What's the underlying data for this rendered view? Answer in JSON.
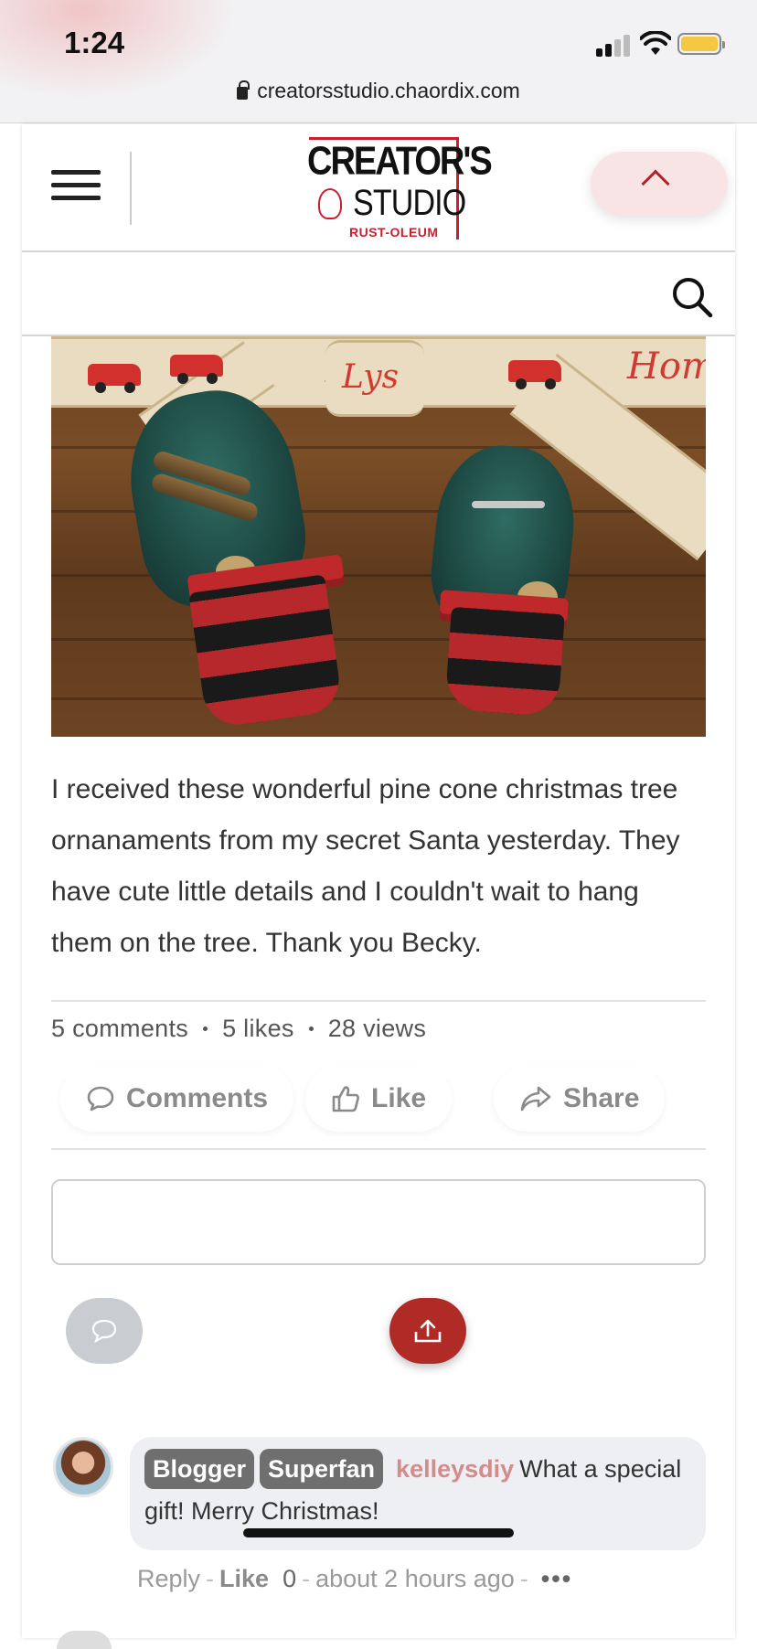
{
  "status_bar": {
    "time": "1:24",
    "url": "creatorsstudio.chaordix.com"
  },
  "header": {
    "logo_line1": "CREATOR'S",
    "logo_line2": "STUDIO",
    "logo_sub": "RUST-OLEUM",
    "brand_color": "#c8202f"
  },
  "post": {
    "body": "I received these wonderful pine cone christmas tree ornanaments from my secret Santa yesterday. They have cute little details and I couldn't wait to hang them on the tree. Thank you Becky.",
    "stats": {
      "comments": "5 comments",
      "likes": "5 likes",
      "views": "28 views"
    },
    "actions": {
      "comments_label": "Comments",
      "like_label": "Like",
      "share_label": "Share"
    }
  },
  "comment_box": {
    "placeholder": ""
  },
  "comments": [
    {
      "badges": [
        "Blogger",
        "Superfan"
      ],
      "username": "kelleysdiy",
      "text": "What a special gift! Merry Christmas!",
      "reply_label": "Reply",
      "like_label": "Like",
      "like_count": "0",
      "time": "about 2 hours ago",
      "more": "•••"
    }
  ],
  "colors": {
    "accent": "#b02a26",
    "username": "#d28c8c",
    "badge": "#6f6f6f"
  }
}
